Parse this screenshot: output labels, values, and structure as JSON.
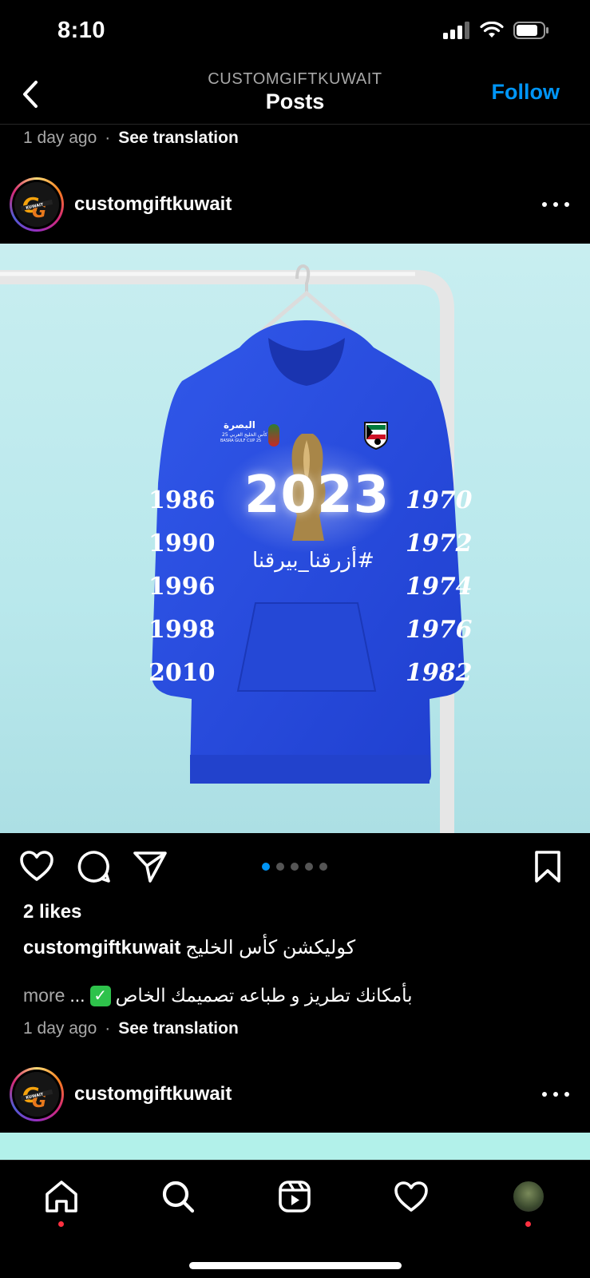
{
  "status": {
    "time": "8:10"
  },
  "header": {
    "account": "CUSTOMGIFTKUWAIT",
    "title": "Posts",
    "follow": "Follow"
  },
  "prev_post": {
    "time": "1 day ago",
    "separator": "·",
    "translate": "See translation"
  },
  "post": {
    "username": "customgiftkuwait",
    "logo_text": "KUWAIT",
    "image": {
      "year": "2023",
      "hashtag": "#أزرقنا_بيرقنا",
      "left_sleeve_years": [
        "1986",
        "1990",
        "1996",
        "1998",
        "2010"
      ],
      "right_sleeve_years": [
        "1970",
        "1972",
        "1974",
        "1976",
        "1982"
      ],
      "badge_text": "البصرة",
      "badge_subtext": "كأس الخليج العربي 25",
      "badge_small": "BASRA GULF CUP 25",
      "hoodie_color": "#2a4fe0"
    },
    "carousel": {
      "count": 5,
      "active_index": 0
    },
    "likes": "2 likes",
    "caption_line1": "كوليكشن كأس الخليج",
    "caption_line2": "بأمكانك تطريز و طباعه تصميمك الخاص",
    "caption_ellipsis": "...",
    "more": "more",
    "check_icon": "✓",
    "time": "1 day ago",
    "separator": "·",
    "translate": "See translation"
  },
  "next_post": {
    "username": "customgiftkuwait"
  },
  "tabbar": {
    "items": [
      "home-icon",
      "search-icon",
      "reels-icon",
      "heart-icon",
      "profile-avatar"
    ],
    "accent": "#ff3040"
  },
  "colors": {
    "link": "#0095f6",
    "secondary_text": "#a8a8a8",
    "background": "#000000"
  }
}
